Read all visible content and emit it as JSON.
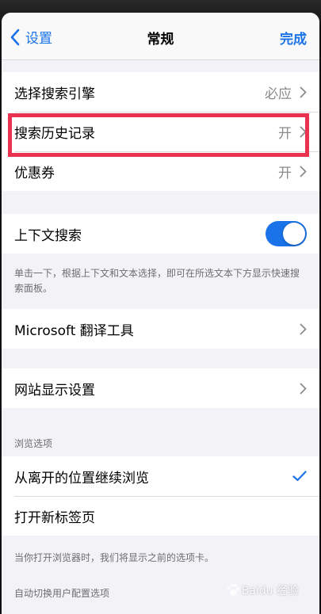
{
  "nav": {
    "back_label": "设置",
    "title": "常规",
    "done_label": "完成"
  },
  "group1": [
    {
      "label": "选择搜索引擎",
      "value": "必应"
    },
    {
      "label": "搜索历史记录",
      "value": "开"
    },
    {
      "label": "优惠券",
      "value": "开"
    }
  ],
  "context_search": {
    "label": "上下文搜索",
    "toggle_on": true,
    "footnote": "单击一下，根据上下文和文本选择，即可在所选文本下方显示快速搜索面板。"
  },
  "translator": {
    "label": "Microsoft 翻译工具"
  },
  "site_display": {
    "label": "网站显示设置"
  },
  "browse": {
    "header": "浏览选项",
    "items": [
      {
        "label": "从离开的位置继续浏览",
        "checked": true
      },
      {
        "label": "打开新标签页",
        "checked": false
      }
    ],
    "footnote": "当你打开浏览器时，我们将显示之前的选项卡。"
  },
  "auto_switch": {
    "header": "自动切换用户配置选项"
  },
  "watermark": {
    "text": "Baidu 经验"
  },
  "colors": {
    "accent": "#1a73e8",
    "highlight": "#e8324f"
  }
}
